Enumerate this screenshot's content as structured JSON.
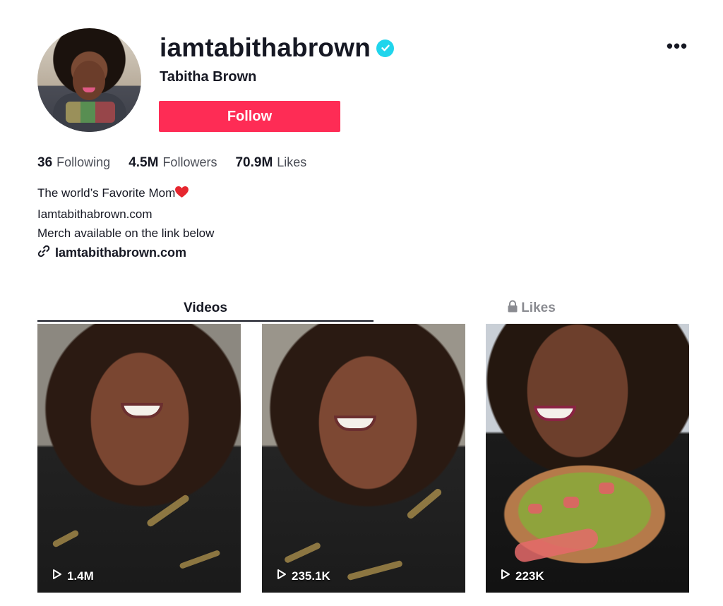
{
  "profile": {
    "username": "iamtabithabrown",
    "display_name": "Tabitha Brown",
    "follow_label": "Follow",
    "more_label": "•••",
    "verified_icon": "verified-badge-icon"
  },
  "stats": [
    {
      "value": "36",
      "label": "Following"
    },
    {
      "value": "4.5M",
      "label": "Followers"
    },
    {
      "value": "70.9M",
      "label": "Likes"
    }
  ],
  "bio": {
    "line1": "The world’s Favorite Mom",
    "line1_emoji": "❤️",
    "line2": "Iamtabithabrown.com",
    "line3": "Merch available on the link below",
    "link": "Iamtabithabrown.com"
  },
  "tabs": {
    "videos": "Videos",
    "likes": "Likes"
  },
  "videos": [
    {
      "views": "1.4M"
    },
    {
      "views": "235.1K"
    },
    {
      "views": "223K"
    }
  ],
  "colors": {
    "accent": "#fe2c55",
    "verified": "#20d5ec",
    "text": "#161823",
    "muted": "#8a8b91"
  }
}
